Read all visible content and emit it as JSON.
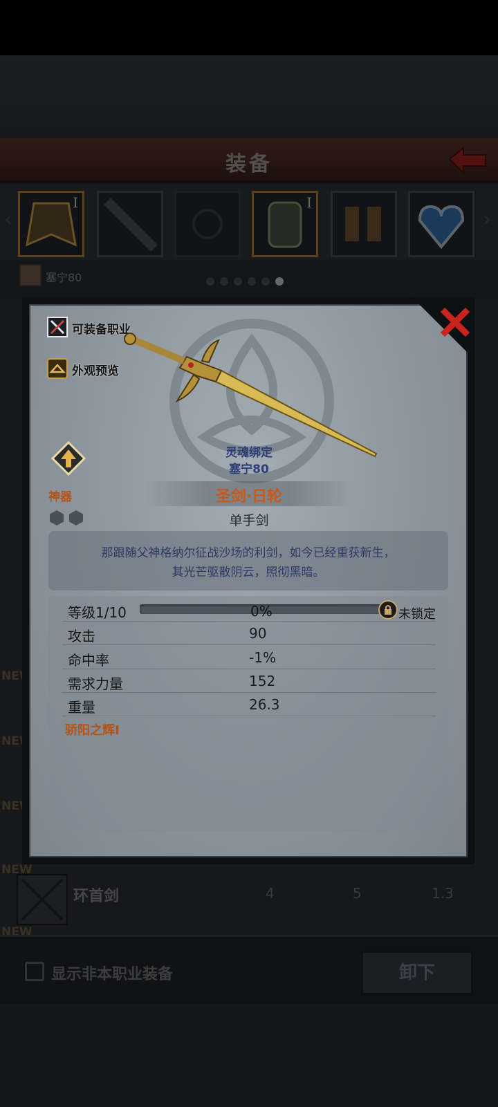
{
  "header": {
    "title": "装备"
  },
  "slots": [
    {
      "mark": "I"
    },
    {
      "mark": ""
    },
    {
      "mark": ""
    },
    {
      "mark": "I"
    },
    {
      "mark": ""
    },
    {
      "mark": ""
    }
  ],
  "owner": {
    "name": "塞宁80"
  },
  "list": {
    "new_label": "NEW",
    "row": {
      "name": "环首剑",
      "v1": "4",
      "v2": "5",
      "v3": "1.3"
    }
  },
  "footer": {
    "show_label": "显示非本职业装备",
    "unequip_label": "卸下"
  },
  "popup": {
    "equippable_class_label": "可装备职业",
    "appearance_preview_label": "外观预览",
    "soul_bound_label": "灵魂绑定",
    "soul_bound_owner": "塞宁80",
    "grade": "神器",
    "item_name": "圣剑·日轮",
    "item_type": "单手剑",
    "description_line1": "那跟随父神格纳尔征战沙场的利剑，如今已经重获新生，",
    "description_line2": "其光芒驱散阴云，照彻黑暗。",
    "level": {
      "label": "等级1/10",
      "percent_text": "0%",
      "progress": 0,
      "lock_label": "未锁定"
    },
    "stats": [
      {
        "label": "攻击",
        "value": "90"
      },
      {
        "label": "命中率",
        "value": "-1%"
      },
      {
        "label": "需求力量",
        "value": "152"
      },
      {
        "label": "重量",
        "value": "26.3"
      }
    ],
    "skill": "骄阳之辉I"
  },
  "colors": {
    "grade_orange": "#b2551c",
    "soul_blue": "#2d3e78",
    "close_red": "#c8241e"
  }
}
